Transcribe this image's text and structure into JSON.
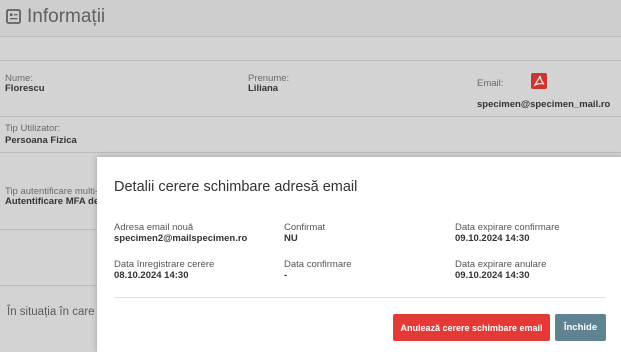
{
  "header": {
    "title": "Informații",
    "icon": "id-card-icon"
  },
  "fields": {
    "nume": {
      "label": "Nume:",
      "value": "Florescu"
    },
    "prenume": {
      "label": "Prenume:",
      "value": "Liliana"
    },
    "email": {
      "label": "Email:",
      "value": "specimen@specimen_mail.ro",
      "icon": "pdf-icon"
    },
    "tip_utilizator": {
      "label": "Tip Utilizator:",
      "value": "Persoana Fizica"
    },
    "tip_autentificare": {
      "label": "Tip autentificare multi-",
      "value": "Autentificare MFA dez"
    }
  },
  "bottom_text": "În situația în care în",
  "modal": {
    "title": "Detalii cerere schimbare adresă email",
    "items": [
      {
        "label": "Adresa email nouă",
        "value": "specimen2@mailspecimen.ro"
      },
      {
        "label": "Confirmat",
        "value": "NU"
      },
      {
        "label": "Data expirare confirmare",
        "value": "09.10.2024 14:30"
      },
      {
        "label": "Data înregistrare cerere",
        "value": "08.10.2024 14:30"
      },
      {
        "label": "Data confirmare",
        "value": "-"
      },
      {
        "label": "Data expirare anulare",
        "value": "09.10.2024 14:30"
      }
    ],
    "cancel_button": "Anulează cerere schimbare email",
    "close_button": "Închide"
  },
  "colors": {
    "accent_red": "#e53935",
    "close_button": "#5f8390"
  }
}
